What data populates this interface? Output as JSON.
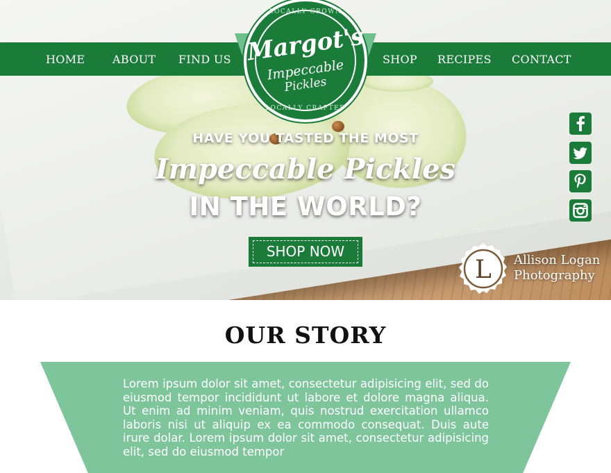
{
  "nav": {
    "home": "HOME",
    "about": "ABOUT",
    "find_us": "FIND US",
    "shop": "SHOP",
    "recipes": "RECIPES",
    "contact": "CONTACT"
  },
  "logo": {
    "brand": "Margot's",
    "tagline1": "Impeccable",
    "tagline2": "Pickles",
    "top_arc": "LOCALLY GROWN",
    "bottom_arc": "LOCALLY CRAFTED"
  },
  "hero": {
    "line1": "HAVE YOU TASTED THE MOST",
    "line2": "Impeccable Pickles",
    "line3": "IN THE WORLD?",
    "cta": "SHOP NOW"
  },
  "social": {
    "facebook": "f",
    "twitter": "t",
    "pinterest": "P",
    "instagram": "ig"
  },
  "credit": {
    "seal_letter": "L",
    "line1": "Allison Logan",
    "line2": "Photography"
  },
  "story": {
    "title": "OUR STORY",
    "body": "Lorem ipsum dolor sit amet, consectetur adipisicing elit, sed do eiusmod tempor incididunt ut labore et dolore magna aliqua. Ut enim ad minim veniam, quis nostrud exercitation ullamco laboris nisi ut aliquip ex ea commodo consequat. Duis aute irure dolar. Lorem ipsum dolor sit amet, consectetur adipisicing elit, sed do eiusmod tempor"
  },
  "colors": {
    "brand_green": "#1b7c3a",
    "mint": "#7fc59c"
  }
}
